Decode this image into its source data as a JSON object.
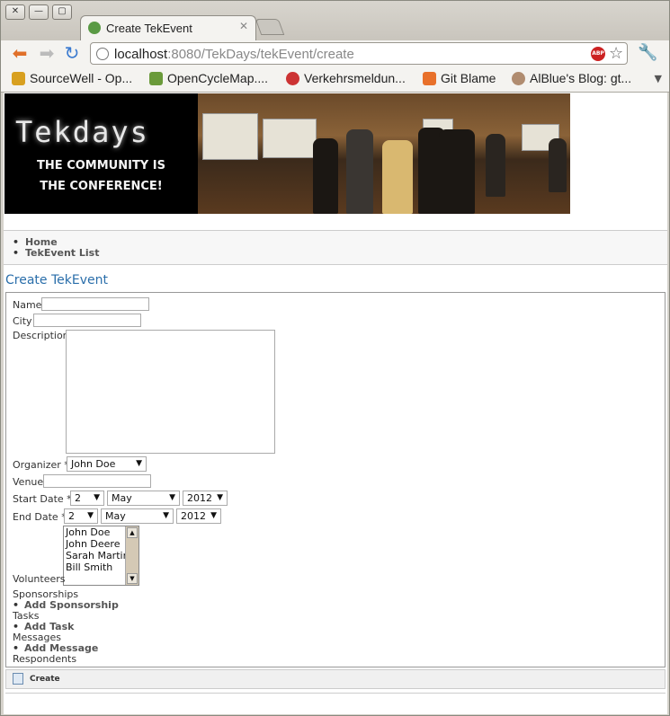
{
  "browser": {
    "tab_title": "Create TekEvent",
    "url_host": "localhost",
    "url_rest": ":8080/TekDays/tekEvent/create",
    "window_buttons": [
      "✕",
      "—",
      "▢"
    ],
    "bookmarks": [
      {
        "label": "SourceWell - Op...",
        "color": "#d8a020"
      },
      {
        "label": "OpenCycleMap....",
        "color": "#6a9a3a"
      },
      {
        "label": "Verkehrsmeldun...",
        "color": "#cc3333"
      },
      {
        "label": "Git Blame",
        "color": "#e8702a"
      },
      {
        "label": "AlBlue's Blog: gt...",
        "color": "#b08c70"
      }
    ]
  },
  "banner": {
    "logo_text": "Tekdays",
    "tagline_1": "THE COMMUNITY IS",
    "tagline_2": "THE CONFERENCE!"
  },
  "nav": {
    "home": "Home",
    "list": "TekEvent List"
  },
  "page": {
    "title": "Create TekEvent"
  },
  "form": {
    "name_label": "Name",
    "city_label": "City",
    "description_label": "Description",
    "organizer_label": "Organizer *",
    "organizer_value": "John Doe",
    "venue_label": "Venue",
    "start_date_label": "Start Date *",
    "end_date_label": "End Date *",
    "date_day": "2",
    "date_month": "May",
    "date_year": "2012",
    "volunteers_label": "Volunteers",
    "volunteers_options": [
      "John Doe",
      "John Deere",
      "Sarah Martin",
      "Bill Smith"
    ],
    "sponsorships_label": "Sponsorships",
    "add_sponsorship": "Add Sponsorship",
    "tasks_label": "Tasks",
    "add_task": "Add Task",
    "messages_label": "Messages",
    "add_message": "Add Message",
    "respondents_label": "Respondents",
    "create_button": "Create"
  }
}
